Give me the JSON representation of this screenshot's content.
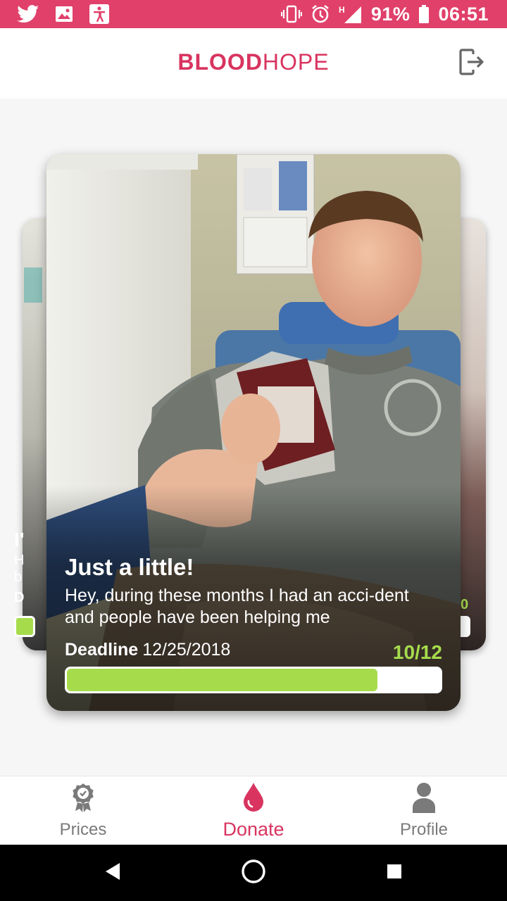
{
  "status_bar": {
    "battery": "91%",
    "time": "06:51",
    "left_icons": [
      "twitter-icon",
      "image-icon",
      "accessibility-icon"
    ],
    "right_icons": [
      "vibrate-icon",
      "alarm-icon",
      "signal-icon",
      "battery-icon"
    ]
  },
  "header": {
    "brand_bold": "BLOOD",
    "brand_light": "HOPE",
    "logout_icon": "logout-icon"
  },
  "card": {
    "title": "Just a little!",
    "description": "Hey, during these months I had an acci-dent and people have been helping me",
    "deadline_label": "Deadline",
    "deadline_date": "12/25/2018",
    "count": "10/12",
    "progress": 0.833
  },
  "side_cards": {
    "left_peek_text": [
      "I'",
      "H",
      "b",
      "D"
    ],
    "right_peek_count": "0"
  },
  "nav": {
    "items": [
      {
        "label": "Prices",
        "icon": "award-icon"
      },
      {
        "label": "Donate",
        "icon": "blood-drop-icon"
      },
      {
        "label": "Profile",
        "icon": "person-icon"
      }
    ]
  },
  "colors": {
    "accent": "#d8345f",
    "status_bar": "#e0406a",
    "progress": "#a6dc4c"
  }
}
